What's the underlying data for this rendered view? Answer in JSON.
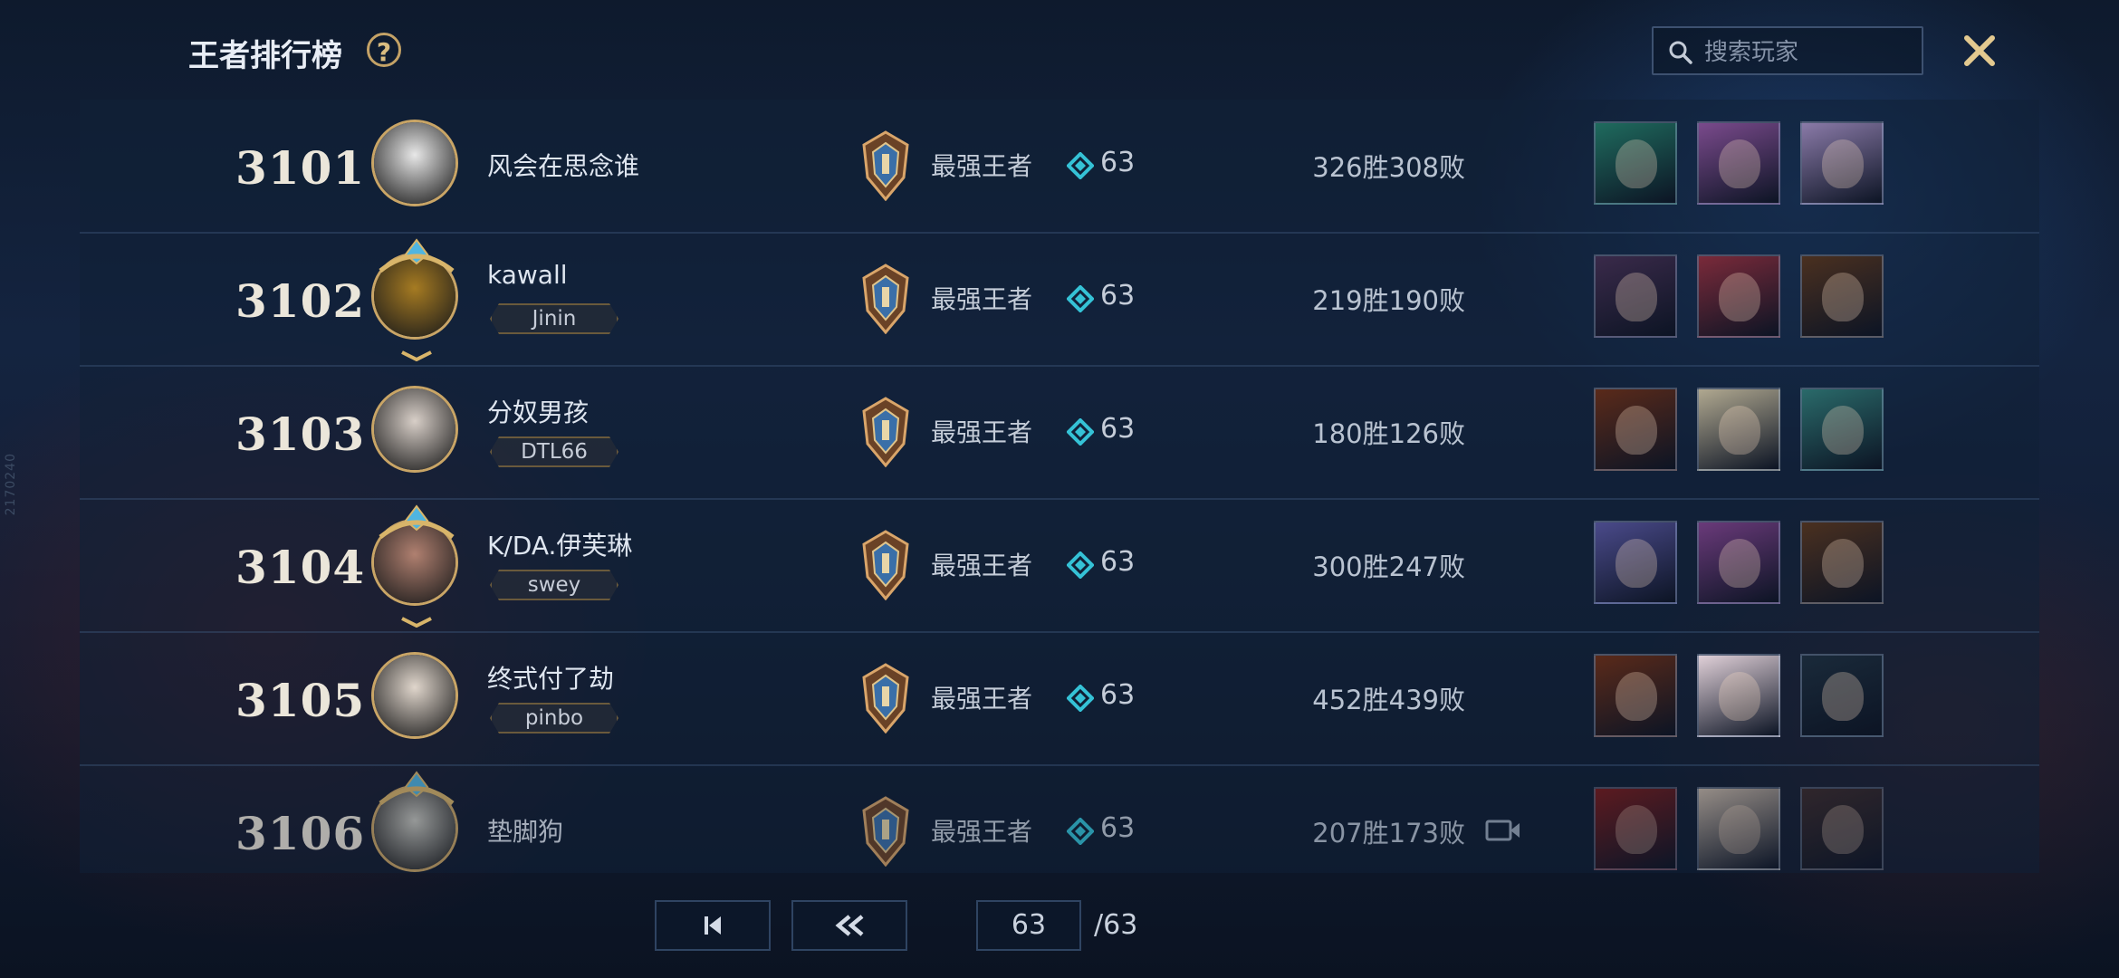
{
  "header": {
    "title": "王者排行榜",
    "help_label": "?",
    "search_placeholder": "搜索玩家"
  },
  "side_mark": "2170240",
  "rows": [
    {
      "rank": "3101",
      "name": "风会在思念谁",
      "tag": "",
      "tier": "最强王者",
      "stars": "63",
      "record": "326胜308败",
      "avatar_color": "#e8e8e8",
      "has_emblem": false,
      "heroes": [
        "#1f6b5e",
        "#7a4a8c",
        "#8a7aa8"
      ]
    },
    {
      "rank": "3102",
      "name": "kawall",
      "tag": "Jinin",
      "tier": "最强王者",
      "stars": "63",
      "record": "219胜190败",
      "avatar_color": "#a67b22",
      "has_emblem": true,
      "heroes": [
        "#3a2a4a",
        "#7a2a3a",
        "#4a3020"
      ]
    },
    {
      "rank": "3103",
      "name": "分奴男孩",
      "tag": "DTL66",
      "tier": "最强王者",
      "stars": "63",
      "record": "180胜126败",
      "avatar_color": "#d8cfc8",
      "has_emblem": false,
      "heroes": [
        "#5a2a1a",
        "#b0a890",
        "#2a6a6a"
      ]
    },
    {
      "rank": "3104",
      "name": "K/DA.伊芙琳",
      "tag": "swey",
      "tier": "最强王者",
      "stars": "63",
      "record": "300胜247败",
      "avatar_color": "#b08070",
      "has_emblem": true,
      "heroes": [
        "#4a4a8a",
        "#6a3a7a",
        "#4a3020"
      ]
    },
    {
      "rank": "3105",
      "name": "终式付了劫",
      "tag": "pinbo",
      "tier": "最强王者",
      "stars": "63",
      "record": "452胜439败",
      "avatar_color": "#e0d6cc",
      "has_emblem": false,
      "heroes": [
        "#5a2a1a",
        "#e0d0d8",
        "#1a2a3a"
      ]
    },
    {
      "rank": "3106",
      "name": "垫脚狗",
      "tag": "",
      "tier": "最强王者",
      "stars": "63",
      "record": "207胜173败",
      "avatar_color": "#c8c8c0",
      "has_emblem": true,
      "heroes": [
        "#7a1a1a",
        "#c8b8a8",
        "#3a2a2a"
      ],
      "has_video": true
    }
  ],
  "pager": {
    "current_page": "63",
    "total_pages": "/63"
  },
  "colors": {
    "gold": "#c9a566",
    "accent_cyan": "#35c2d6"
  }
}
